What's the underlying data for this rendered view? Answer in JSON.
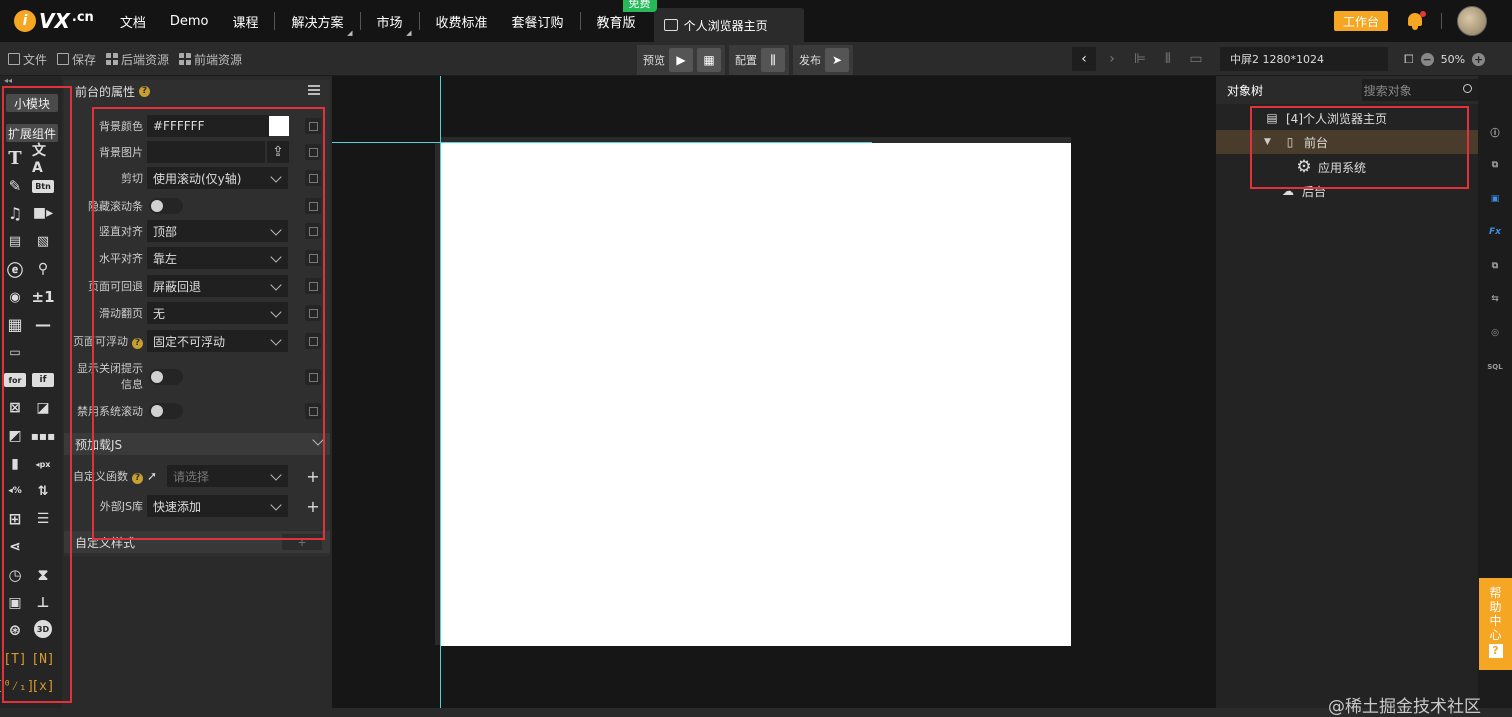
{
  "topnav": {
    "logo": {
      "mark": "i",
      "brand": "VX",
      "tld": ".cn"
    },
    "items": [
      "文档",
      "Demo",
      "课程",
      "解决方案",
      "市场",
      "收费标准",
      "套餐订购",
      "教育版"
    ],
    "edu_badge": "免费",
    "active_tab": "个人浏览器主页",
    "workbench_button": "工作台"
  },
  "toolbar": {
    "file": "文件",
    "save": "保存",
    "backend_resources": "后端资源",
    "frontend_resources": "前端资源",
    "preview": "预览",
    "config": "配置",
    "publish": "发布",
    "screen_select": "中屏2 1280*1024",
    "zoom": "50%"
  },
  "leftbar": {
    "small_module": "小模块",
    "extended_components": "扩展组件"
  },
  "props": {
    "title": "前台的属性",
    "bg_color_label": "背景颜色",
    "bg_color_value": "#FFFFFF",
    "bg_image_label": "背景图片",
    "clip_label": "剪切",
    "clip_value": "使用滚动(仅y轴)",
    "hide_scroll_label": "隐藏滚动条",
    "valign_label": "竖直对齐",
    "valign_value": "顶部",
    "halign_label": "水平对齐",
    "halign_value": "靠左",
    "back_label": "页面可回退",
    "back_value": "屏蔽回退",
    "swipe_label": "滑动翻页",
    "swipe_value": "无",
    "float_label": "页面可浮动",
    "float_value": "固定不可浮动",
    "close_tip_label_1": "显示关闭提示",
    "close_tip_label_2": "信息",
    "disable_scroll_label": "禁用系统滚动",
    "preload_js": "预加载JS",
    "custom_fn_label": "自定义函数",
    "custom_fn_placeholder": "请选择",
    "external_js_label": "外部JS库",
    "external_js_value": "快速添加",
    "custom_style": "自定义样式"
  },
  "object_tree": {
    "tab": "对象树",
    "search_placeholder": "搜索对象",
    "root": "[4]个人浏览器主页",
    "frontend": "前台",
    "app_system": "应用系统",
    "backend": "后台"
  },
  "help": [
    "帮",
    "助",
    "中",
    "心"
  ],
  "help_mark": "?",
  "watermark": "@稀土掘金技术社区",
  "colors": {
    "accent": "#f5a623",
    "highlight": "#e0323a",
    "guide": "#4fd2d9",
    "free_badge": "#27b85a"
  }
}
